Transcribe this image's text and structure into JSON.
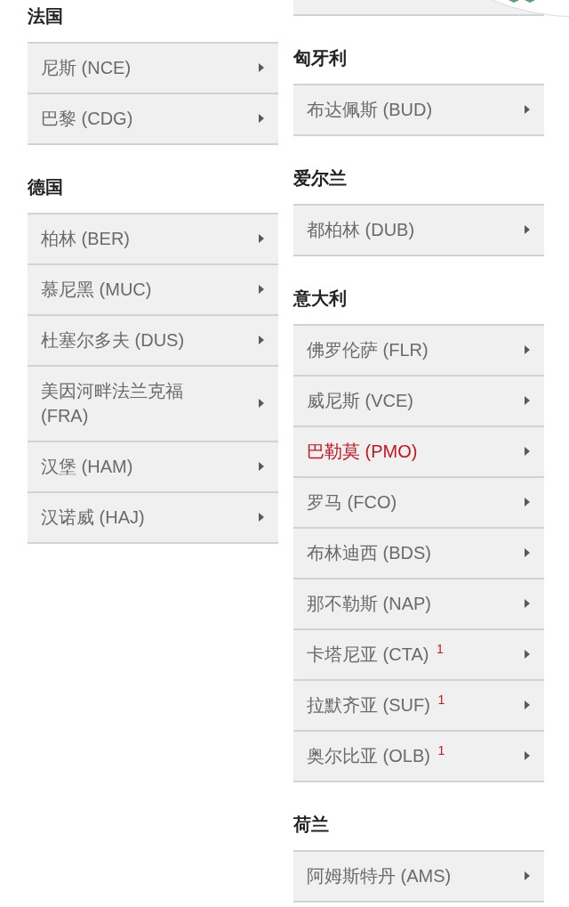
{
  "columns": [
    {
      "sections": [
        {
          "country": "法国",
          "airports": [
            {
              "name": "尼斯 (NCE)",
              "selected": false
            },
            {
              "name": "巴黎 (CDG)",
              "selected": false
            }
          ]
        },
        {
          "country": "德国",
          "airports": [
            {
              "name": "柏林 (BER)",
              "selected": false
            },
            {
              "name": "慕尼黑 (MUC)",
              "selected": false
            },
            {
              "name": "杜塞尔多夫 (DUS)",
              "selected": false
            },
            {
              "name": "美因河畔法兰克福 (FRA)",
              "selected": false
            },
            {
              "name": "汉堡 (HAM)",
              "selected": false
            },
            {
              "name": "汉诺威 (HAJ)",
              "selected": false
            }
          ]
        }
      ]
    },
    {
      "partial_row_above": true,
      "sections": [
        {
          "country": "匈牙利",
          "airports": [
            {
              "name": "布达佩斯 (BUD)",
              "selected": false
            }
          ]
        },
        {
          "country": "爱尔兰",
          "airports": [
            {
              "name": "都柏林 (DUB)",
              "selected": false
            }
          ]
        },
        {
          "country": "意大利",
          "airports": [
            {
              "name": "佛罗伦萨 (FLR)",
              "selected": false
            },
            {
              "name": "威尼斯 (VCE)",
              "selected": false
            },
            {
              "name": "巴勒莫 (PMO)",
              "selected": true
            },
            {
              "name": "罗马 (FCO)",
              "selected": false
            },
            {
              "name": "布林迪西 (BDS)",
              "selected": false
            },
            {
              "name": "那不勒斯 (NAP)",
              "selected": false
            },
            {
              "name": "卡塔尼亚 (CTA) $^{1}$",
              "selected": false
            },
            {
              "name": "拉默齐亚 (SUF) $^{1}$",
              "selected": false
            },
            {
              "name": "奥尔比亚 (OLB) $^{1}$",
              "selected": false
            }
          ]
        },
        {
          "country": "荷兰",
          "airports": [
            {
              "name": "阿姆斯特丹 (AMS)",
              "selected": false
            }
          ]
        }
      ]
    }
  ]
}
